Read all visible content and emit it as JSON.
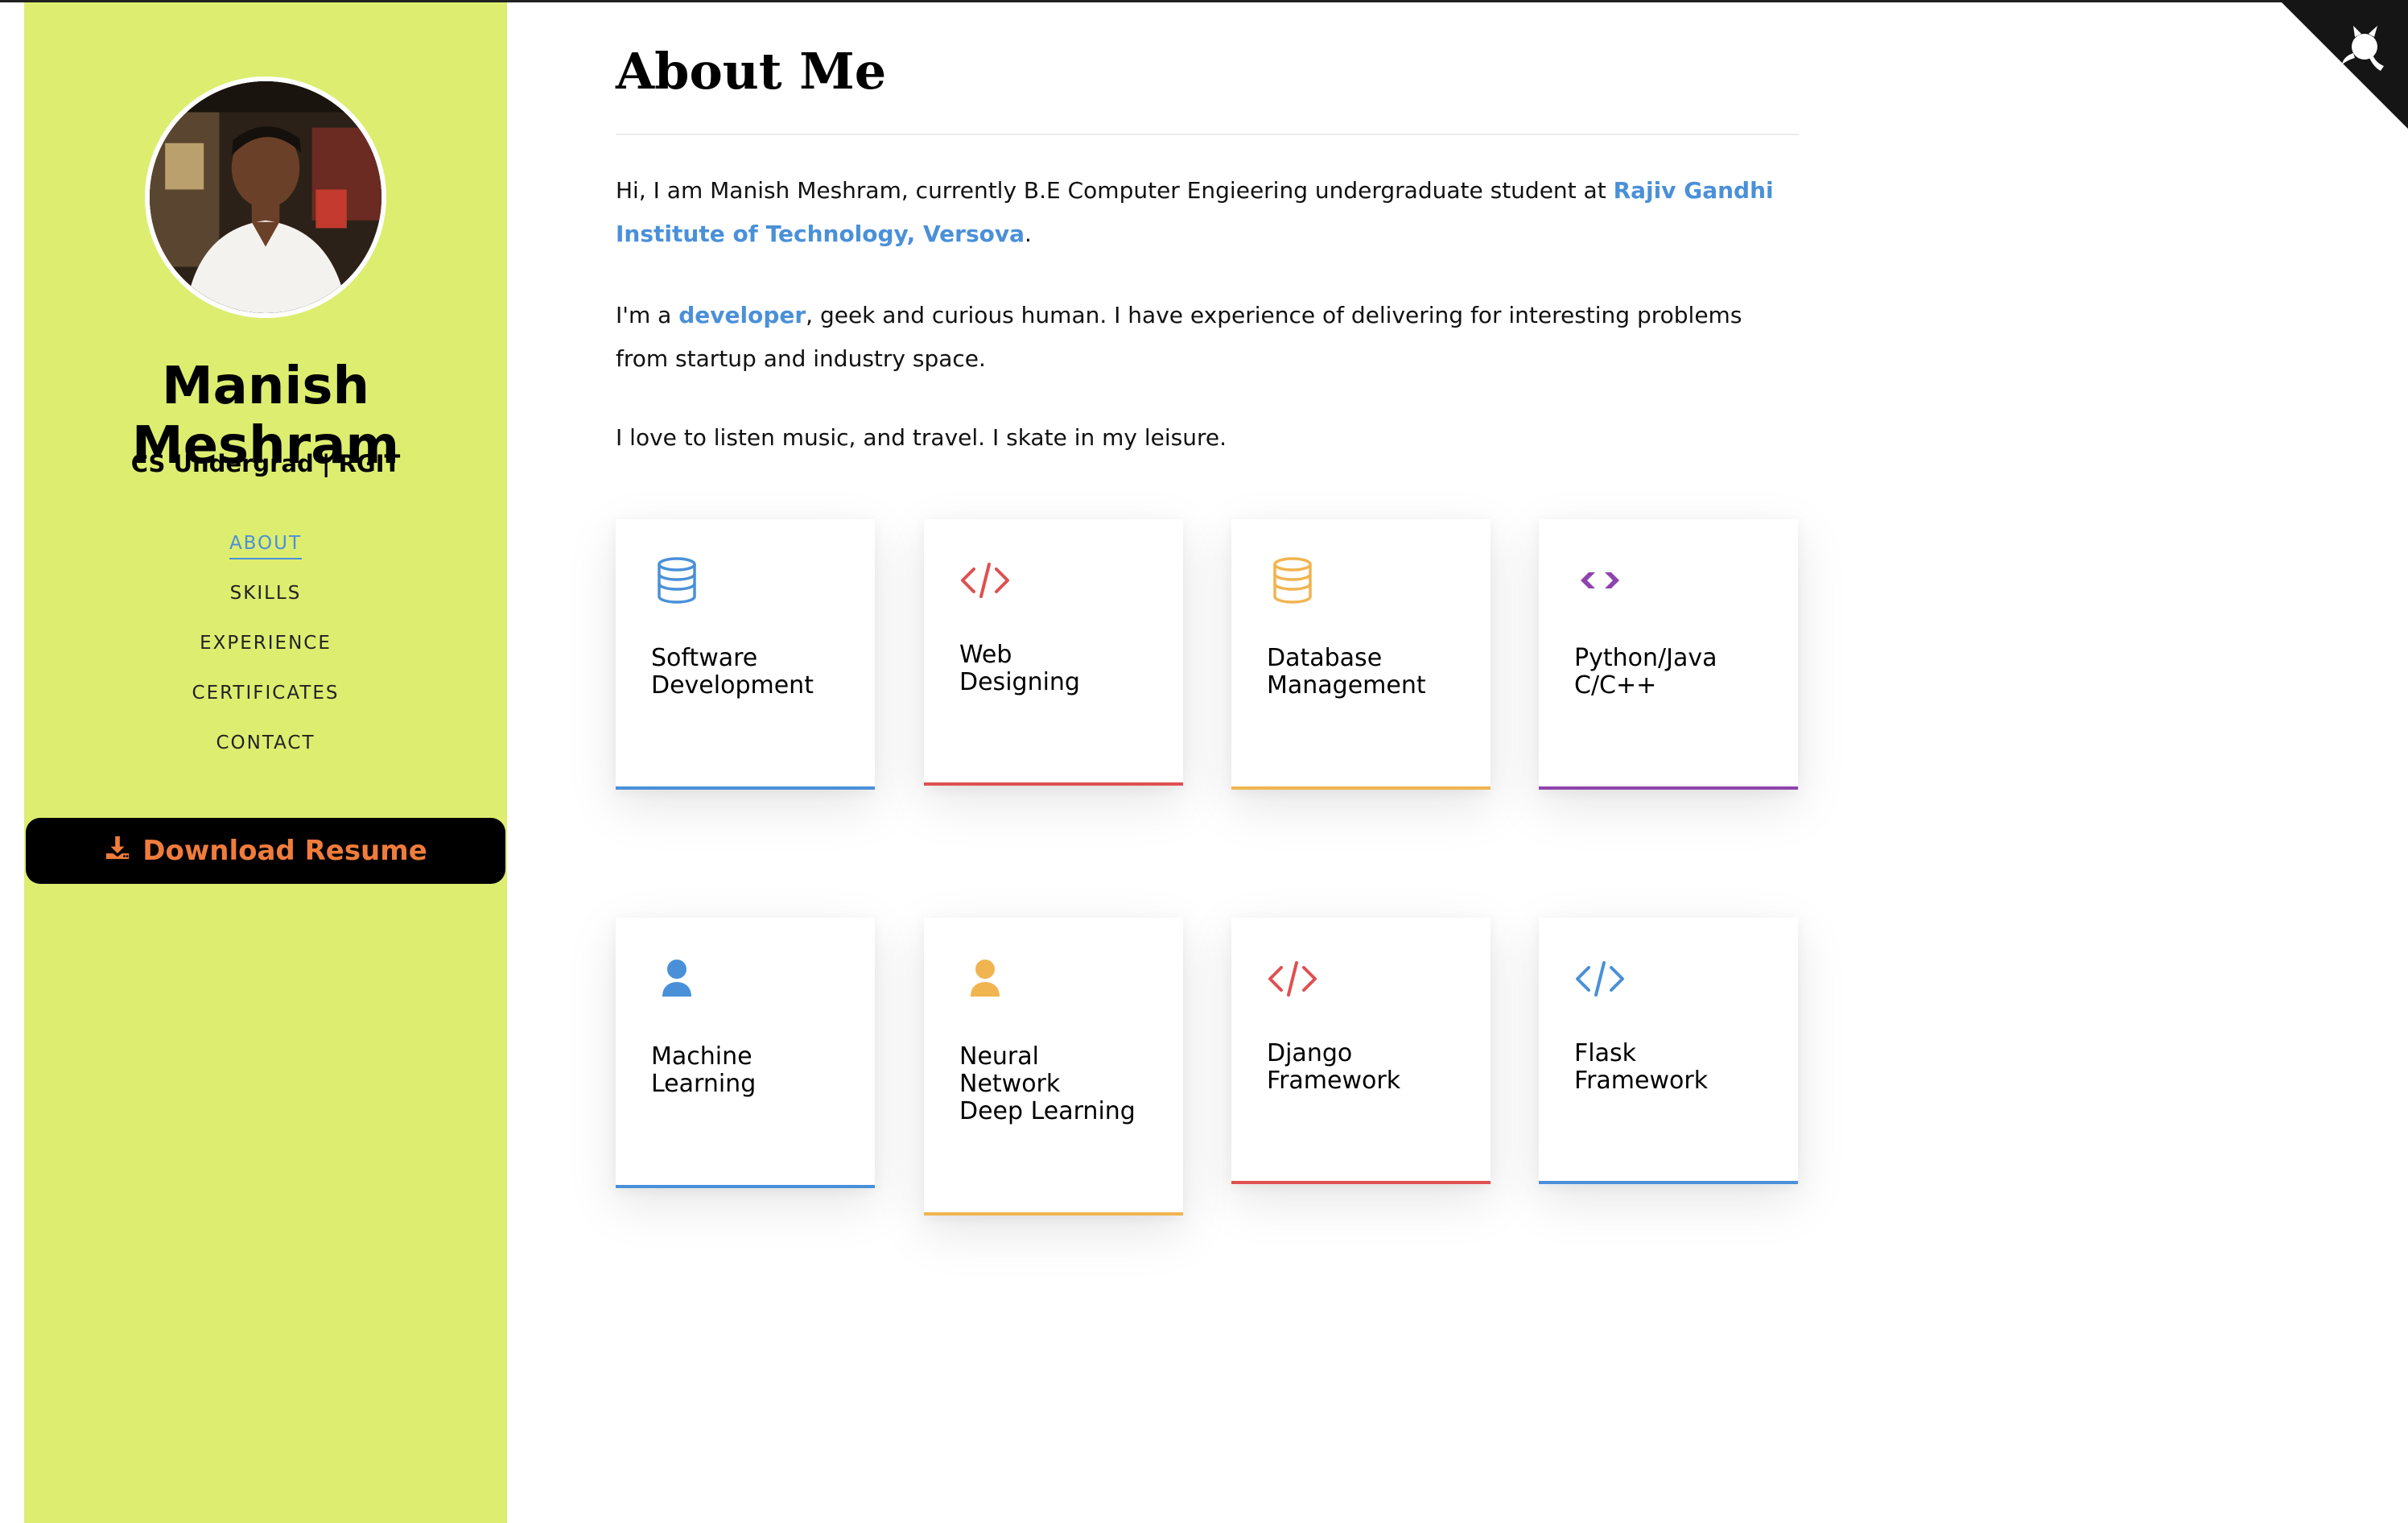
{
  "sidebar": {
    "name": "Manish Meshram",
    "subtitle": "CS Undergrad | RGIT",
    "background_color": "#dded70",
    "nav": [
      {
        "label": "ABOUT",
        "active": true
      },
      {
        "label": "SKILLS",
        "active": false
      },
      {
        "label": "EXPERIENCE",
        "active": false
      },
      {
        "label": "CERTIFICATES",
        "active": false
      },
      {
        "label": "CONTACT",
        "active": false
      }
    ],
    "download_label": "Download Resume",
    "download_icon": "download-icon",
    "download_color": "#f07c3c"
  },
  "about": {
    "title": "About Me",
    "p1_before": "Hi, I am Manish Meshram, currently B.E Computer Engieering undergraduate student at ",
    "p1_link": "Rajiv Gandhi Institute of Technology, Versova",
    "p1_after": ".",
    "p2_before": "I'm a ",
    "p2_link": "developer",
    "p2_after": ", geek and curious human. I have experience of delivering for interesting problems from startup and industry space.",
    "p3": "I love to listen music, and travel. I skate in my leisure.",
    "link_color": "#4a90d9"
  },
  "skills": [
    {
      "lines": [
        "Software",
        "Development"
      ],
      "icon": "database-icon",
      "color": "#4a90d9"
    },
    {
      "lines": [
        "Web",
        "Designing"
      ],
      "icon": "code-icon",
      "color": "#e05050"
    },
    {
      "lines": [
        "Database",
        "Management"
      ],
      "icon": "database-icon",
      "color": "#f0b450"
    },
    {
      "lines": [
        "Python/Java",
        "C/C++"
      ],
      "icon": "diamond-code-icon",
      "color": "#8e44ad"
    },
    {
      "lines": [
        "Machine",
        "Learning"
      ],
      "icon": "user-icon",
      "color": "#4a90d9"
    },
    {
      "lines": [
        "Neural",
        "Network",
        "Deep Learning"
      ],
      "icon": "user-icon",
      "color": "#f0b450"
    },
    {
      "lines": [
        "Django",
        "Framework"
      ],
      "icon": "code-icon",
      "color": "#e05050"
    },
    {
      "lines": [
        "Flask",
        "Framework"
      ],
      "icon": "code-icon",
      "color": "#4a90d9"
    }
  ],
  "github_corner_icon": "github-octocat-icon"
}
